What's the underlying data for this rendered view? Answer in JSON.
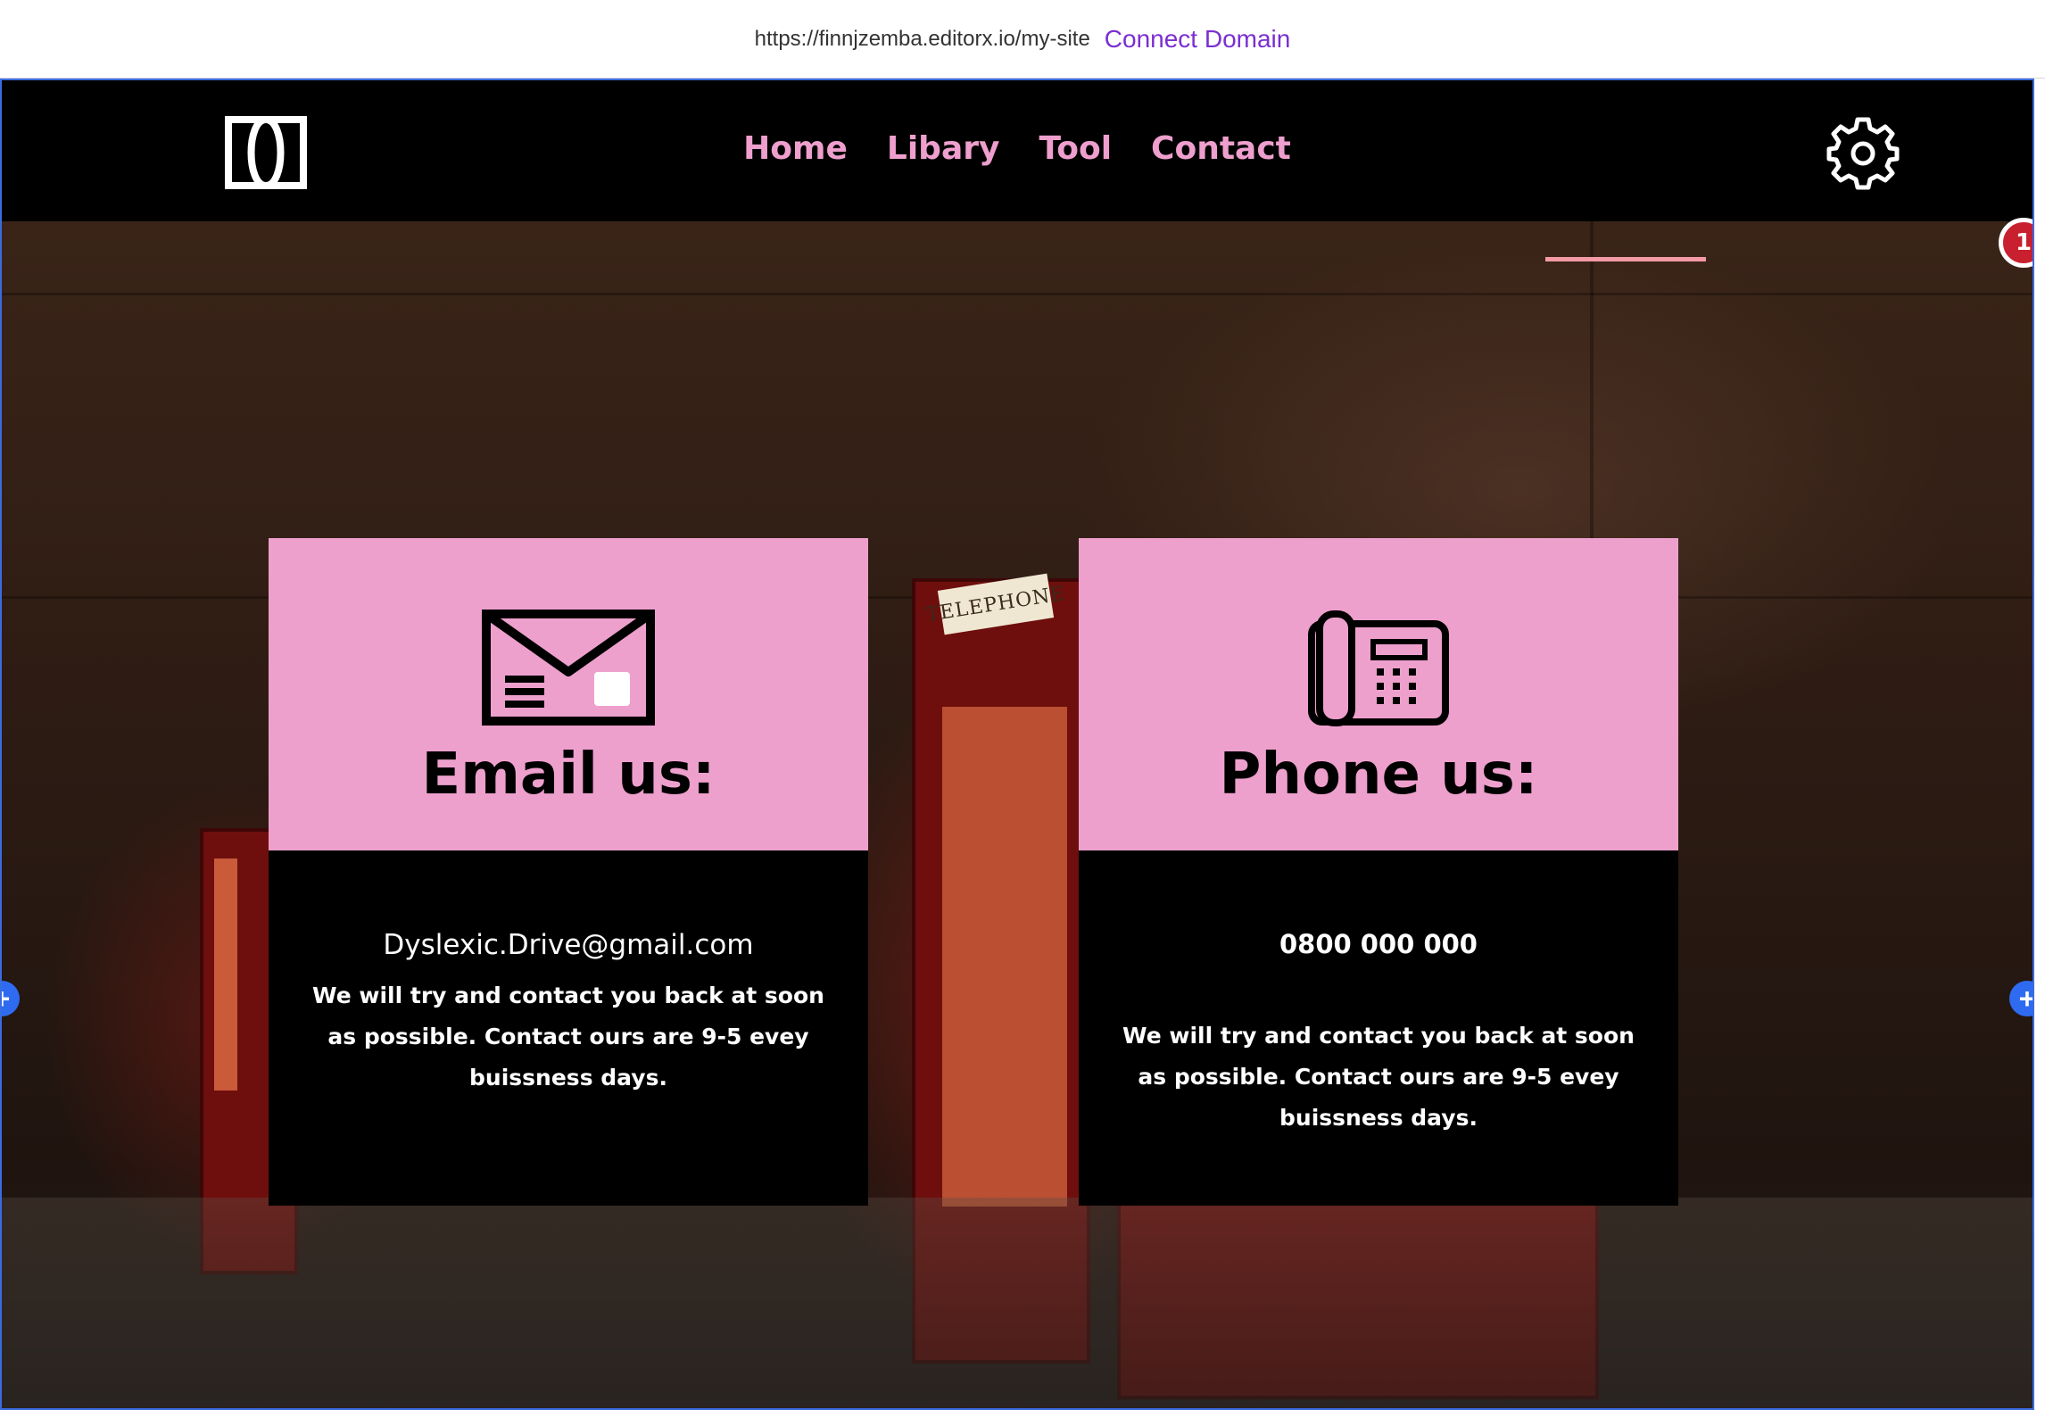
{
  "editor": {
    "url": "https://finnjzemba.editorx.io/my-site",
    "connect_domain": "Connect Domain"
  },
  "header": {
    "logo_icon": "dd-monogram-logo",
    "nav": [
      "Home",
      "Libary",
      "Tool",
      "Contact"
    ],
    "settings_icon": "gear-icon",
    "nav_color": "#ee9fcd"
  },
  "hero": {
    "background": "night street with red telephone booths",
    "sign_text": "TELEPHONE"
  },
  "badge": {
    "count": "1",
    "color": "#c8202e"
  },
  "cards": [
    {
      "icon": "envelope-icon",
      "heading": "Email us:",
      "primary": "Dyslexic.Drive@gmail.com",
      "note": "We will try and contact you back at soon as possible. Contact ours are 9-5 evey buissness days."
    },
    {
      "icon": "desk-phone-icon",
      "heading": "Phone us:",
      "primary": "0800 000 000",
      "note": "We will try and contact you back at soon as possible. Contact ours are 9-5 evey buissness days."
    }
  ],
  "colors": {
    "card_top": "#eea0cd",
    "card_bottom": "#000000",
    "accent_line": "#f39aa7",
    "editor_handle": "#2f6bf0"
  }
}
